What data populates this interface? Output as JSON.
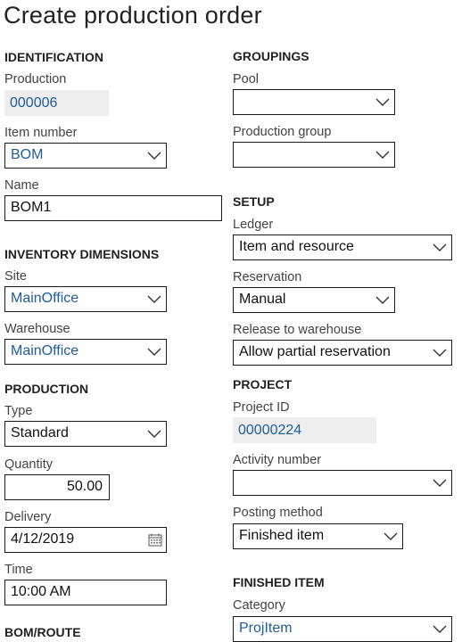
{
  "page": {
    "title": "Create production order"
  },
  "left": {
    "identification": {
      "heading": "IDENTIFICATION",
      "production": {
        "label": "Production",
        "value": "000006"
      },
      "item_number": {
        "label": "Item number",
        "value": "BOM"
      },
      "name": {
        "label": "Name",
        "value": "BOM1"
      }
    },
    "inventory_dimensions": {
      "heading": "INVENTORY DIMENSIONS",
      "site": {
        "label": "Site",
        "value": "MainOffice"
      },
      "warehouse": {
        "label": "Warehouse",
        "value": "MainOffice"
      }
    },
    "production": {
      "heading": "PRODUCTION",
      "type": {
        "label": "Type",
        "value": "Standard"
      },
      "quantity": {
        "label": "Quantity",
        "value": "50.00"
      },
      "delivery": {
        "label": "Delivery",
        "value": "4/12/2019"
      },
      "time": {
        "label": "Time",
        "value": "10:00 AM"
      }
    },
    "bom_route": {
      "heading": "BOM/ROUTE"
    }
  },
  "right": {
    "groupings": {
      "heading": "GROUPINGS",
      "pool": {
        "label": "Pool",
        "value": ""
      },
      "production_group": {
        "label": "Production group",
        "value": ""
      }
    },
    "setup": {
      "heading": "SETUP",
      "ledger": {
        "label": "Ledger",
        "value": "Item and resource"
      },
      "reservation": {
        "label": "Reservation",
        "value": "Manual"
      },
      "release_to_warehouse": {
        "label": "Release to warehouse",
        "value": "Allow partial reservation"
      }
    },
    "project": {
      "heading": "PROJECT",
      "project_id": {
        "label": "Project ID",
        "value": "00000224"
      },
      "activity_number": {
        "label": "Activity number",
        "value": ""
      },
      "posting_method": {
        "label": "Posting method",
        "value": "Finished item"
      }
    },
    "finished_item": {
      "heading": "FINISHED ITEM",
      "category": {
        "label": "Category",
        "value": "ProjItem"
      }
    }
  },
  "icons": {
    "dropdown": "chevron-down-icon",
    "date_picker": "calendar-icon"
  },
  "colors": {
    "link_value": "#1f5c99",
    "readonly_background": "#eeeeee",
    "field_border": "#1a1a1a"
  }
}
